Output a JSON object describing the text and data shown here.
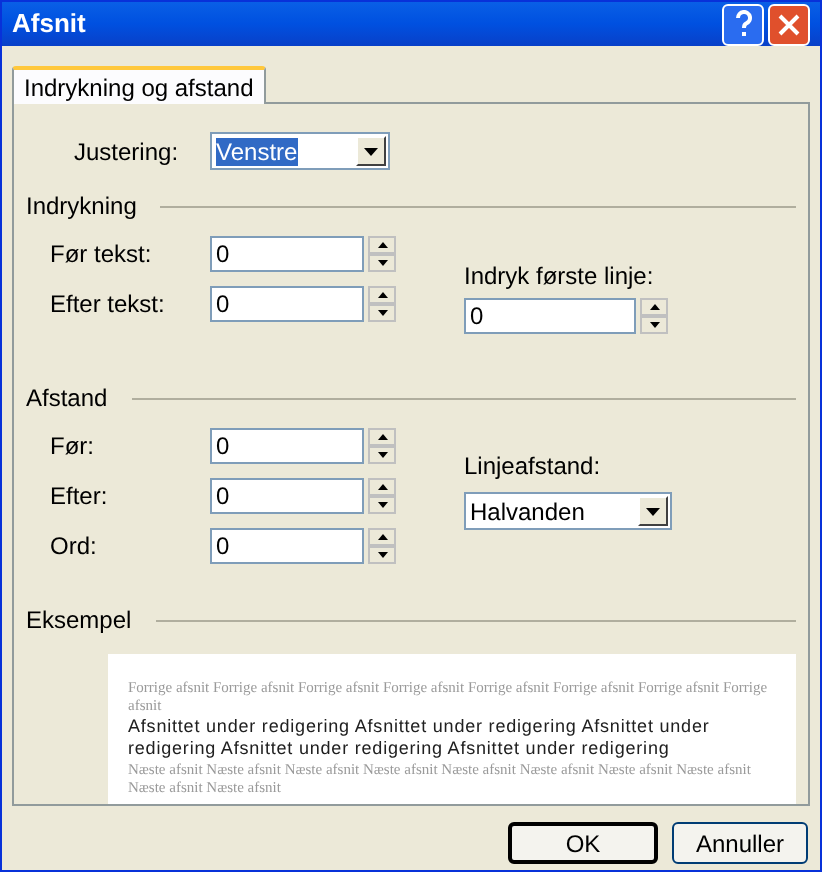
{
  "window": {
    "title": "Afsnit"
  },
  "tabs": [
    {
      "label": "Indrykning og afstand",
      "selected": true
    }
  ],
  "alignment": {
    "label": "Justering:",
    "value": "Venstre",
    "focused": true
  },
  "indent": {
    "heading": "Indrykning",
    "fields": [
      {
        "label": "Før tekst:",
        "value": "0"
      },
      {
        "label": "Efter tekst:",
        "value": "0"
      }
    ],
    "first_line": {
      "label": "Indryk første linje:",
      "value": "0"
    }
  },
  "spacing": {
    "heading": "Afstand",
    "fields": [
      {
        "label": "Før:",
        "value": "0"
      },
      {
        "label": "Efter:",
        "value": "0"
      },
      {
        "label": "Ord:",
        "value": "0"
      }
    ],
    "line_spacing": {
      "label": "Linjeafstand:",
      "value": "Halvanden"
    }
  },
  "preview": {
    "heading": "Eksempel",
    "previous": "Forrige afsnit Forrige afsnit Forrige afsnit Forrige afsnit Forrige afsnit Forrige afsnit Forrige afsnit Forrige afsnit",
    "current": "Afsnittet under redigering Afsnittet under redigering Afsnittet under redigering Afsnittet under redigering Afsnittet under redigering",
    "next": "Næste afsnit Næste afsnit Næste afsnit Næste afsnit Næste afsnit Næste afsnit Næste afsnit Næste afsnit Næste afsnit Næste afsnit"
  },
  "buttons": [
    {
      "label": "OK",
      "default": true
    },
    {
      "label": "Annuller",
      "default": false
    }
  ]
}
